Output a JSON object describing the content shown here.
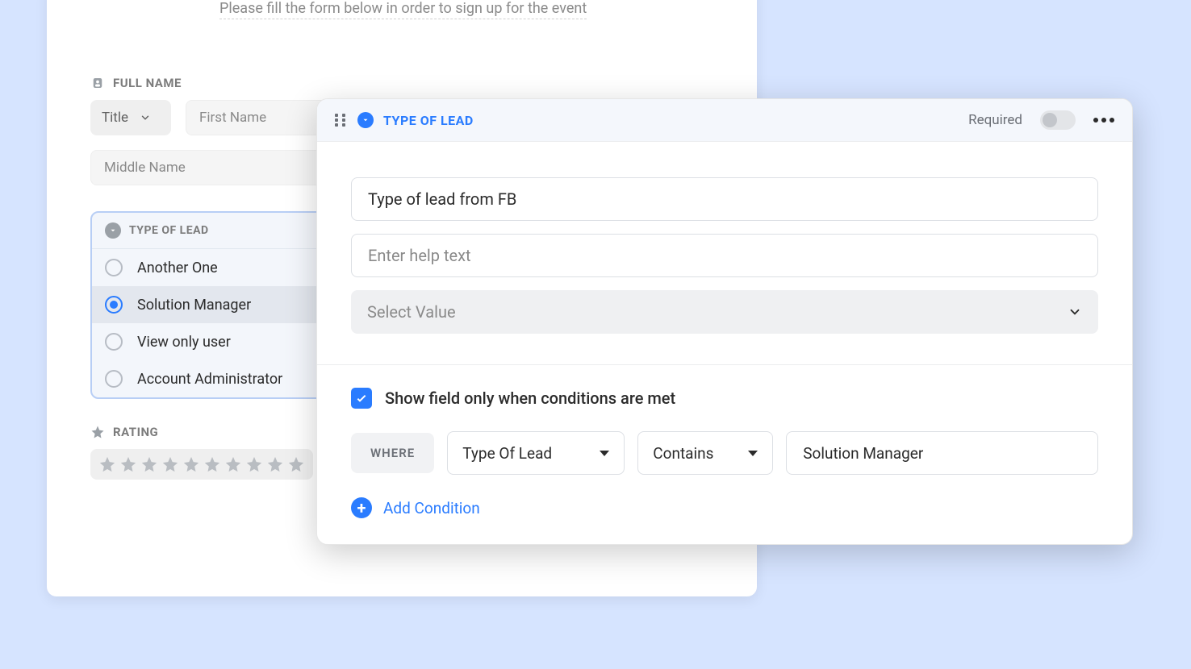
{
  "form": {
    "subtitle": "Please fill the form below in order to sign up for the event",
    "full_name": {
      "label": "FULL NAME",
      "title_label": "Title",
      "first_name_placeholder": "First Name",
      "middle_name_placeholder": "Middle Name"
    },
    "type_of_lead": {
      "label": "TYPE OF LEAD",
      "options": [
        {
          "label": "Another One",
          "selected": false
        },
        {
          "label": "Solution Manager",
          "selected": true
        },
        {
          "label": "View only user",
          "selected": false
        },
        {
          "label": "Account Administrator",
          "selected": false
        }
      ]
    },
    "rating": {
      "label": "RATING",
      "count": 10
    }
  },
  "editor": {
    "title": "TYPE OF LEAD",
    "required_label": "Required",
    "display_name": "Type of lead from FB",
    "help_placeholder": "Enter help text",
    "select_value_placeholder": "Select Value",
    "conditions_checkbox_label": "Show field only when conditions are met",
    "where_label": "WHERE",
    "where_field": "Type Of Lead",
    "where_operator": "Contains",
    "where_value": "Solution Manager",
    "add_condition_label": "Add Condition"
  }
}
